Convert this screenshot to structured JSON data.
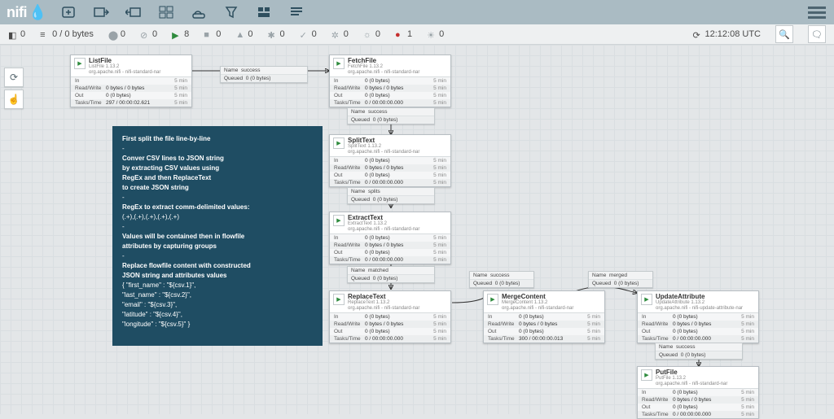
{
  "brand": {
    "name": "nifi"
  },
  "status": {
    "threads": "0",
    "queued": "0 / 0 bytes",
    "stopped": "0",
    "invalid": "0",
    "running": "8",
    "transmitting": "0",
    "warn": "0",
    "up": "0",
    "sync": "0",
    "refresh": "0",
    "remote": "0",
    "err": "1",
    "info": "0",
    "time": "12:12:08 UTC"
  },
  "note": {
    "t1": "First split the file line-by-line",
    "t2": "Conver CSV lines to JSON string",
    "t3": "by extracting CSV values using",
    "t4": "RegEx and then ReplaceText",
    "t5": "to create JSON string",
    "t6": "RegEx to extract comm-delimited values:",
    "t7": "(.+),(.+),(.+),(.+),(.+)",
    "t8": "Values will be contained then in flowfile",
    "t9": "attributes by capturing groups",
    "t10": "Replace flowfile content with constructed",
    "t11": "JSON string and attributes values",
    "t12": "{ \"first_name\" : \"${csv.1}\",",
    "t13": "\"last_name\" : \"${csv.2}\",",
    "t14": "\"email\" : \"${csv.3}\",",
    "t15": "\"latitude\" : \"${csv.4}\",",
    "t16": "\"longitude\" : \"${csv.5}\" }"
  },
  "rows": {
    "in": "In",
    "rw": "Read/Write",
    "out": "Out",
    "tt": "Tasks/Time",
    "v_zero_5": "0 (0 bytes)",
    "v_rw": "0 bytes / 0 bytes",
    "v_out": "0 (0 bytes)",
    "v_tt0": "0 / 00:00:00.000",
    "five": "5 min"
  },
  "procs": {
    "list": {
      "name": "ListFile",
      "ver": "ListFile 1.13.2",
      "bund": "org.apache.nifi - nifi-standard-nar",
      "tt": "297 / 00:00:02.621"
    },
    "fetch": {
      "name": "FetchFile",
      "ver": "FetchFile 1.13.2",
      "bund": "org.apache.nifi - nifi-standard-nar"
    },
    "split": {
      "name": "SplitText",
      "ver": "SplitText 1.13.2",
      "bund": "org.apache.nifi - nifi-standard-nar"
    },
    "extract": {
      "name": "ExtractText",
      "ver": "ExtractText 1.13.2",
      "bund": "org.apache.nifi - nifi-standard-nar"
    },
    "replace": {
      "name": "ReplaceText",
      "ver": "ReplaceText 1.13.2",
      "bund": "org.apache.nifi - nifi-standard-nar"
    },
    "merge": {
      "name": "MergeContent",
      "ver": "MergeContent 1.13.2",
      "bund": "org.apache.nifi - nifi-standard-nar",
      "tt": "300 / 00:00:00.013"
    },
    "update": {
      "name": "UpdateAttribute",
      "ver": "UpdateAttribute 1.13.2",
      "bund": "org.apache.nifi - nifi-update-attribute-nar"
    },
    "put": {
      "name": "PutFile",
      "ver": "PutFile 1.13.2",
      "bund": "org.apache.nifi - nifi-standard-nar"
    }
  },
  "conns": {
    "name": "Name",
    "queued": "Queued",
    "q0": "0 (0 bytes)",
    "success": "success",
    "splits": "splits",
    "matched": "matched",
    "merged": "merged"
  }
}
